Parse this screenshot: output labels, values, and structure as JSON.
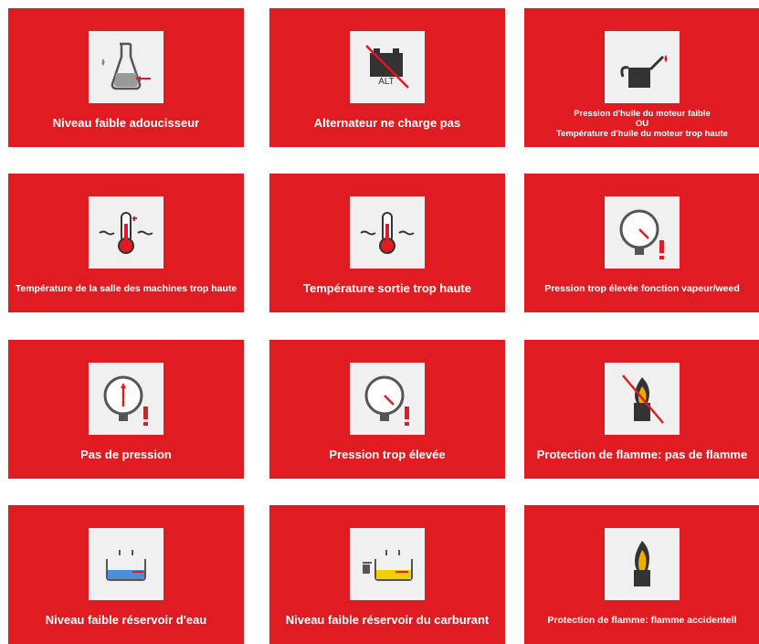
{
  "colors": {
    "card_bg": "#e01b22",
    "icon_bg": "#f0f0f0",
    "text": "#ffffff",
    "alert": "#e01b22"
  },
  "alarms": [
    {
      "label": "Niveau faible adoucisseur",
      "icon": "softener-icon"
    },
    {
      "label": "Alternateur ne charge pas",
      "icon": "alternator-icon"
    },
    {
      "lines": [
        "Pression d'huile du moteur faible",
        "OU",
        "Température d'huile du moteur trop haute"
      ],
      "icon": "oil-can-icon"
    },
    {
      "label": "Température de la salle des machines trop haute",
      "icon": "thermometer-icon"
    },
    {
      "label": "Température sortie trop haute",
      "icon": "thermometer-icon"
    },
    {
      "label": "Pression trop élevée fonction vapeur/weed",
      "icon": "pressure-gauge-icon"
    },
    {
      "label": "Pas de pression",
      "icon": "pressure-gauge-icon"
    },
    {
      "label": "Pression trop élevée",
      "icon": "pressure-gauge-icon"
    },
    {
      "label": "Protection de flamme: pas de flamme",
      "icon": "no-flame-icon"
    },
    {
      "label": "Niveau faible réservoir d'eau",
      "icon": "water-tank-icon"
    },
    {
      "label": "Niveau faible réservoir du carburant",
      "icon": "fuel-tank-icon"
    },
    {
      "label": "Protection de flamme: flamme accidentell",
      "icon": "flame-icon"
    }
  ],
  "alternator_text": "ALT"
}
